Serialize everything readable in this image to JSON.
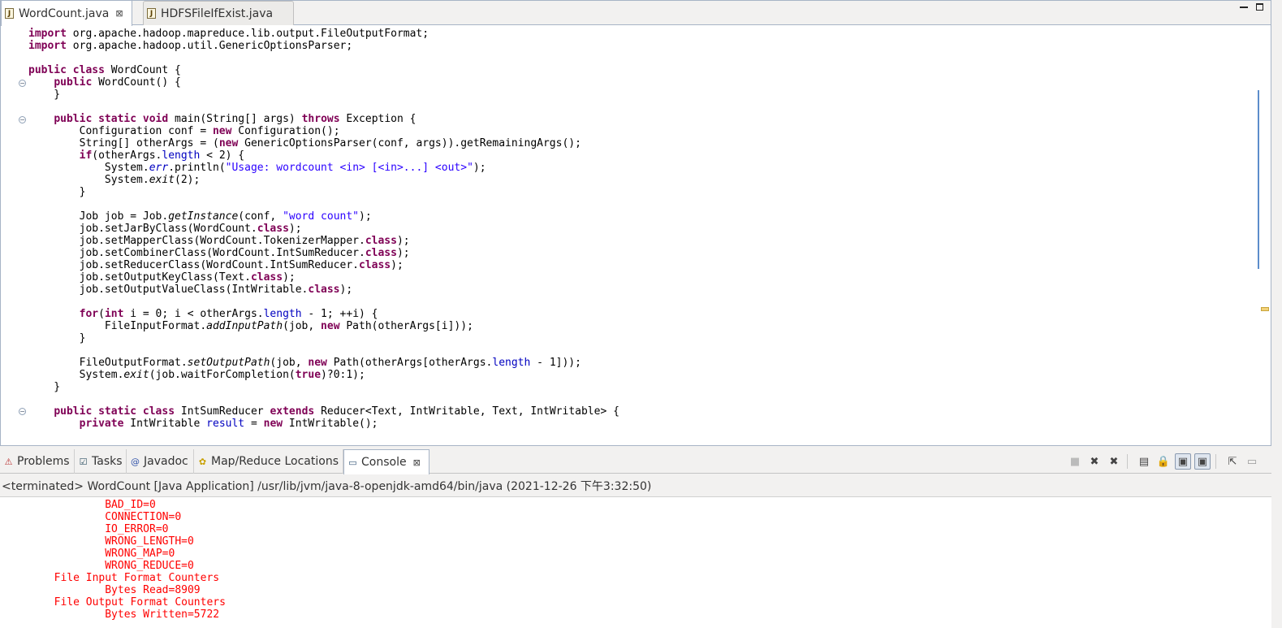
{
  "editor": {
    "tabs": [
      {
        "label": "WordCount.java",
        "active": true
      },
      {
        "label": "HDFSFileIfExist.java",
        "active": false
      }
    ],
    "code_lines": [
      [
        [
          "import",
          "kw"
        ],
        [
          " org.apache.hadoop.mapreduce.lib.output.FileOutputFormat;",
          ""
        ]
      ],
      [
        [
          "import",
          "kw"
        ],
        [
          " org.apache.hadoop.util.GenericOptionsParser;",
          ""
        ]
      ],
      [],
      [
        [
          "public",
          "kw"
        ],
        [
          " ",
          ""
        ],
        [
          "class",
          "kw"
        ],
        [
          " WordCount {",
          ""
        ]
      ],
      [
        [
          "    ",
          ""
        ],
        [
          "public",
          "kw"
        ],
        [
          " WordCount() {",
          ""
        ]
      ],
      [
        [
          "    }",
          ""
        ]
      ],
      [],
      [
        [
          "    ",
          ""
        ],
        [
          "public",
          "kw"
        ],
        [
          " ",
          ""
        ],
        [
          "static",
          "kw"
        ],
        [
          " ",
          ""
        ],
        [
          "void",
          "kw"
        ],
        [
          " main(String[] args) ",
          ""
        ],
        [
          "throws",
          "kw"
        ],
        [
          " Exception {",
          ""
        ]
      ],
      [
        [
          "        Configuration conf = ",
          ""
        ],
        [
          "new",
          "kw"
        ],
        [
          " Configuration();",
          ""
        ]
      ],
      [
        [
          "        String[] otherArgs = (",
          ""
        ],
        [
          "new",
          "kw"
        ],
        [
          " GenericOptionsParser(conf, args)).getRemainingArgs();",
          ""
        ]
      ],
      [
        [
          "        ",
          ""
        ],
        [
          "if",
          "kw"
        ],
        [
          "(otherArgs.",
          ""
        ],
        [
          "length",
          "fld"
        ],
        [
          " < 2) {",
          ""
        ]
      ],
      [
        [
          "            System.",
          ""
        ],
        [
          "err",
          "fld it"
        ],
        [
          ".println(",
          ""
        ],
        [
          "\"Usage: wordcount <in> [<in>...] <out>\"",
          "str"
        ],
        [
          ");",
          ""
        ]
      ],
      [
        [
          "            System.",
          ""
        ],
        [
          "exit",
          "it"
        ],
        [
          "(2);",
          ""
        ]
      ],
      [
        [
          "        }",
          ""
        ]
      ],
      [],
      [
        [
          "        Job job = Job.",
          ""
        ],
        [
          "getInstance",
          "it"
        ],
        [
          "(conf, ",
          ""
        ],
        [
          "\"word count\"",
          "str"
        ],
        [
          ");",
          ""
        ]
      ],
      [
        [
          "        job.setJarByClass(WordCount.",
          ""
        ],
        [
          "class",
          "kw"
        ],
        [
          ");",
          ""
        ]
      ],
      [
        [
          "        job.setMapperClass(WordCount.TokenizerMapper.",
          ""
        ],
        [
          "class",
          "kw"
        ],
        [
          ");",
          ""
        ]
      ],
      [
        [
          "        job.setCombinerClass(WordCount.IntSumReducer.",
          ""
        ],
        [
          "class",
          "kw"
        ],
        [
          ");",
          ""
        ]
      ],
      [
        [
          "        job.setReducerClass(WordCount.IntSumReducer.",
          ""
        ],
        [
          "class",
          "kw"
        ],
        [
          ");",
          ""
        ]
      ],
      [
        [
          "        job.setOutputKeyClass(Text.",
          ""
        ],
        [
          "class",
          "kw"
        ],
        [
          ");",
          ""
        ]
      ],
      [
        [
          "        job.setOutputValueClass(IntWritable.",
          ""
        ],
        [
          "class",
          "kw"
        ],
        [
          ");",
          ""
        ]
      ],
      [],
      [
        [
          "        ",
          ""
        ],
        [
          "for",
          "kw"
        ],
        [
          "(",
          ""
        ],
        [
          "int",
          "kw"
        ],
        [
          " i = 0; i < otherArgs.",
          ""
        ],
        [
          "length",
          "fld"
        ],
        [
          " - 1; ++i) {",
          ""
        ]
      ],
      [
        [
          "            FileInputFormat.",
          ""
        ],
        [
          "addInputPath",
          "it"
        ],
        [
          "(job, ",
          ""
        ],
        [
          "new",
          "kw"
        ],
        [
          " Path(otherArgs[i]));",
          ""
        ]
      ],
      [
        [
          "        }",
          ""
        ]
      ],
      [],
      [
        [
          "        FileOutputFormat.",
          ""
        ],
        [
          "setOutputPath",
          "it"
        ],
        [
          "(job, ",
          ""
        ],
        [
          "new",
          "kw"
        ],
        [
          " Path(otherArgs[otherArgs.",
          ""
        ],
        [
          "length",
          "fld"
        ],
        [
          " - 1]));",
          ""
        ]
      ],
      [
        [
          "        System.",
          ""
        ],
        [
          "exit",
          "it"
        ],
        [
          "(job.waitForCompletion(",
          ""
        ],
        [
          "true",
          "kw"
        ],
        [
          ")?0:1);",
          ""
        ]
      ],
      [
        [
          "    }",
          ""
        ]
      ],
      [],
      [
        [
          "    ",
          ""
        ],
        [
          "public",
          "kw"
        ],
        [
          " ",
          ""
        ],
        [
          "static",
          "kw"
        ],
        [
          " ",
          ""
        ],
        [
          "class",
          "kw"
        ],
        [
          " IntSumReducer ",
          ""
        ],
        [
          "extends",
          "kw"
        ],
        [
          " Reducer<Text, IntWritable, Text, IntWritable> {",
          ""
        ]
      ],
      [
        [
          "        ",
          ""
        ],
        [
          "private",
          "kw"
        ],
        [
          " IntWritable ",
          ""
        ],
        [
          "result",
          "fld"
        ],
        [
          " = ",
          ""
        ],
        [
          "new",
          "kw"
        ],
        [
          " IntWritable();",
          ""
        ]
      ]
    ]
  },
  "views": {
    "tabs": [
      {
        "label": "Problems",
        "icon": "problems-icon"
      },
      {
        "label": "Tasks",
        "icon": "tasks-icon"
      },
      {
        "label": "Javadoc",
        "icon": "javadoc-icon"
      },
      {
        "label": "Map/Reduce Locations",
        "icon": "mapreduce-icon"
      },
      {
        "label": "Console",
        "icon": "console-icon"
      }
    ]
  },
  "console": {
    "header": "<terminated> WordCount [Java Application] /usr/lib/jvm/java-8-openjdk-amd64/bin/java (2021-12-26 下午3:32:50)",
    "lines": [
      "\t\tBAD_ID=0",
      "\t\tCONNECTION=0",
      "\t\tIO_ERROR=0",
      "\t\tWRONG_LENGTH=0",
      "\t\tWRONG_MAP=0",
      "\t\tWRONG_REDUCE=0",
      "\tFile Input Format Counters ",
      "\t\tBytes Read=8909",
      "\tFile Output Format Counters ",
      "\t\tBytes Written=5722"
    ]
  },
  "colors": {
    "keyword": "#7f0055",
    "string": "#2a00ff",
    "field": "#0000c0",
    "console_error": "#ff0000"
  }
}
